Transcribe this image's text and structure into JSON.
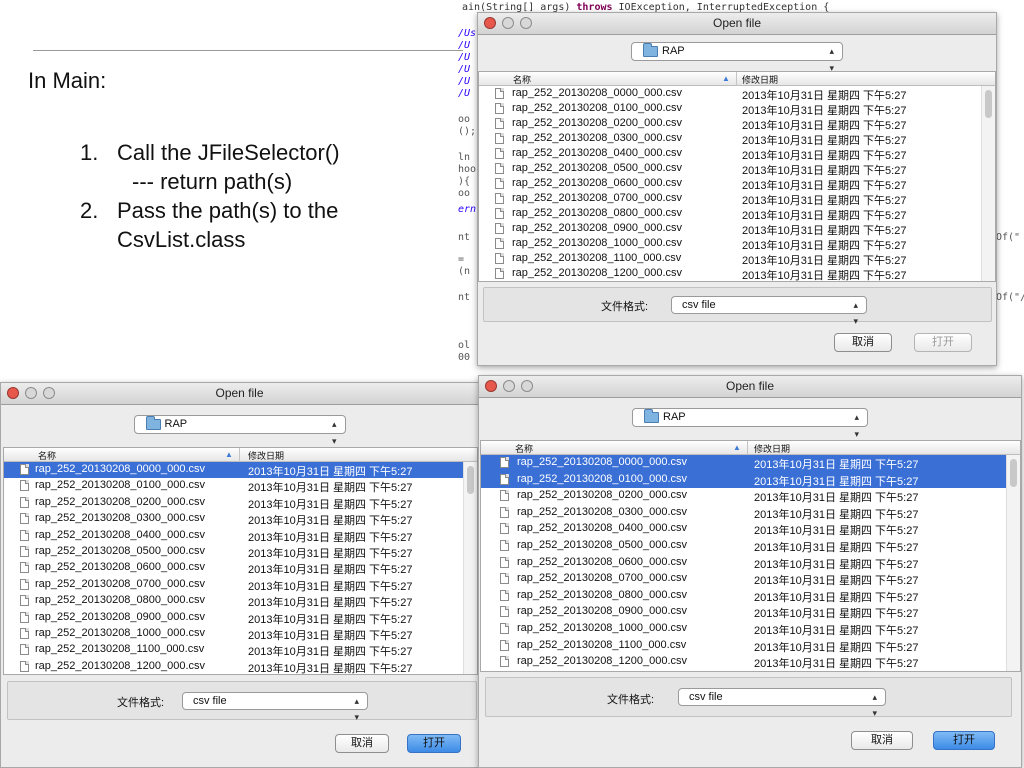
{
  "slide": {
    "heading": "In Main:",
    "items": [
      {
        "num": "1.",
        "text": "Call the JFileSelector()",
        "sub": "--- return path(s)"
      },
      {
        "num": "2.",
        "text": "Pass the path(s) to the",
        "cont": "CsvList.class"
      }
    ]
  },
  "code_editor": {
    "top_line": {
      "pre": "ain(String[] args) ",
      "kw": "throws",
      "post": " IOException, InterruptedException {"
    },
    "left_fragments": [
      "/Us",
      "/U",
      "/U",
      "/U",
      "/U",
      "/U",
      "oo",
      "();",
      "ln",
      "hoo",
      "){",
      "oo",
      "ern",
      "nt",
      "=",
      "(n",
      "nt",
      "ol",
      "00"
    ],
    "right_fragments": [
      "Of(\"",
      "Of(\"/"
    ]
  },
  "dialog": {
    "title": "Open file",
    "folder": "RAP",
    "col_name": "名称",
    "col_date": "修改日期",
    "files": [
      "rap_252_20130208_0000_000.csv",
      "rap_252_20130208_0100_000.csv",
      "rap_252_20130208_0200_000.csv",
      "rap_252_20130208_0300_000.csv",
      "rap_252_20130208_0400_000.csv",
      "rap_252_20130208_0500_000.csv",
      "rap_252_20130208_0600_000.csv",
      "rap_252_20130208_0700_000.csv",
      "rap_252_20130208_0800_000.csv",
      "rap_252_20130208_0900_000.csv",
      "rap_252_20130208_1000_000.csv",
      "rap_252_20130208_1100_000.csv",
      "rap_252_20130208_1200_000.csv"
    ],
    "date": "2013年10月31日 星期四 下午5:27",
    "format_label": "文件格式:",
    "format_value": "csv file",
    "cancel": "取消",
    "open": "打开"
  },
  "colors": {
    "selection": "#3a6fd6",
    "primary_button": "#3d8be6"
  }
}
